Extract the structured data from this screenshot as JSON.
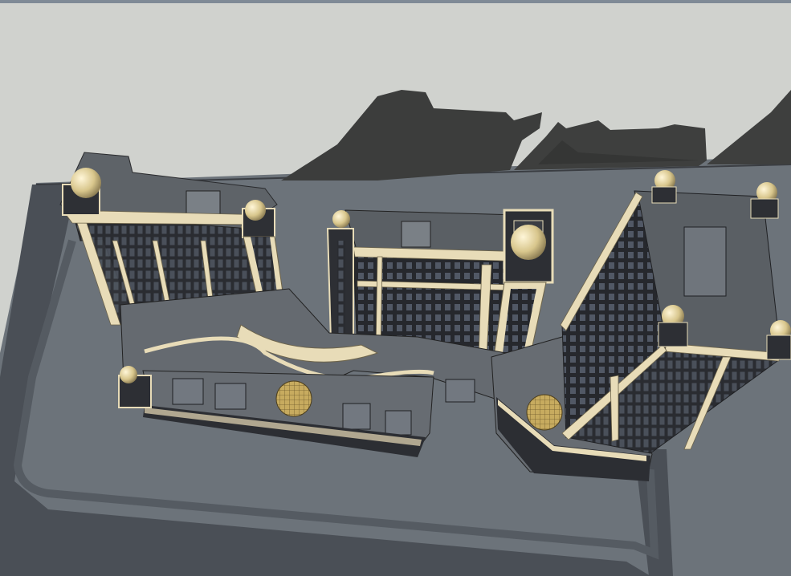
{
  "viewport": {
    "tool": "3d-model-viewport",
    "scene": "hotel-complex-aerial-view"
  },
  "colors": {
    "sky": "#d0d2ce",
    "shadow": "#3d3e3d",
    "pavement": "#6c737a",
    "road": "#4d5259",
    "facade_cream": "#e8dcb8",
    "facade_dark": "#27282c",
    "window": "#474c55",
    "roof": "#5f6469",
    "dome": "#d9c78e",
    "gold_dome": "#b79a4d"
  }
}
